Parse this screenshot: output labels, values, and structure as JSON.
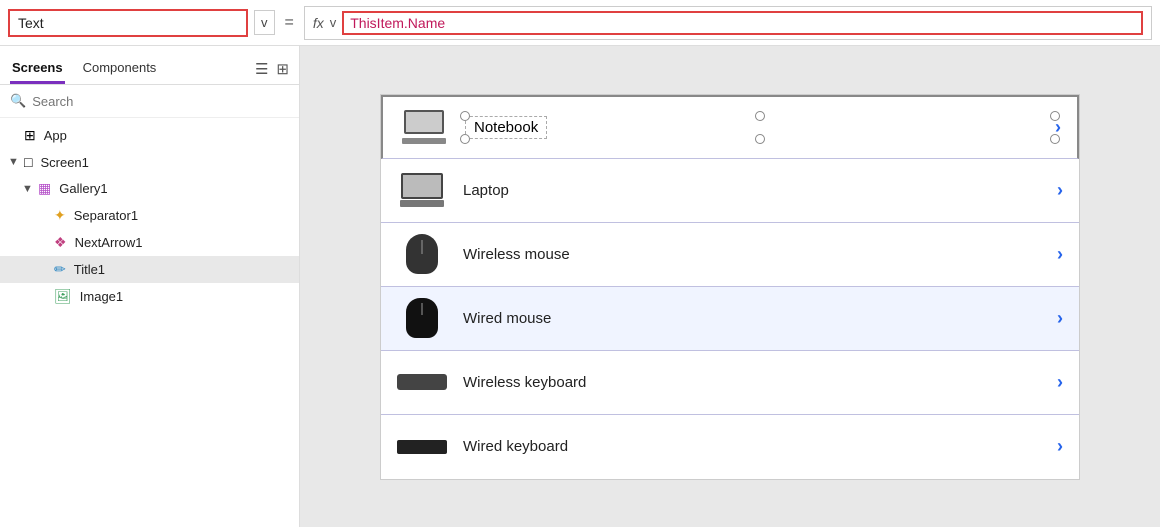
{
  "topbar": {
    "text_input_value": "Text",
    "dropdown_label": "v",
    "equals": "=",
    "fx_label": "fx",
    "formula_chevron": "v",
    "formula_value": "ThisItem.Name"
  },
  "sidebar": {
    "tab_screens": "Screens",
    "tab_components": "Components",
    "search_placeholder": "Search",
    "tree_items": [
      {
        "id": "app",
        "label": "App",
        "icon": "⊞",
        "indent": 1,
        "chevron": ""
      },
      {
        "id": "screen1",
        "label": "Screen1",
        "icon": "□",
        "indent": 1,
        "chevron": "▼"
      },
      {
        "id": "gallery1",
        "label": "Gallery1",
        "icon": "▦",
        "indent": 2,
        "chevron": "▼"
      },
      {
        "id": "separator1",
        "label": "Separator1",
        "icon": "⊹",
        "indent": 3,
        "chevron": ""
      },
      {
        "id": "nextarrow1",
        "label": "NextArrow1",
        "icon": "❖",
        "indent": 3,
        "chevron": ""
      },
      {
        "id": "title1",
        "label": "Title1",
        "icon": "✏",
        "indent": 3,
        "chevron": "",
        "selected": true
      },
      {
        "id": "image1",
        "label": "Image1",
        "icon": "🖼",
        "indent": 3,
        "chevron": ""
      }
    ]
  },
  "gallery": {
    "items": [
      {
        "id": "notebook",
        "label": "Notebook",
        "device": "notebook",
        "selected": true
      },
      {
        "id": "laptop",
        "label": "Laptop",
        "device": "laptop"
      },
      {
        "id": "wireless-mouse",
        "label": "Wireless mouse",
        "device": "wmouse"
      },
      {
        "id": "wired-mouse",
        "label": "Wired mouse",
        "device": "wiredmouse",
        "highlighted": true
      },
      {
        "id": "wireless-keyboard",
        "label": "Wireless keyboard",
        "device": "wkeyboard"
      },
      {
        "id": "wired-keyboard",
        "label": "Wired keyboard",
        "device": "wiredkeyboard"
      }
    ]
  }
}
